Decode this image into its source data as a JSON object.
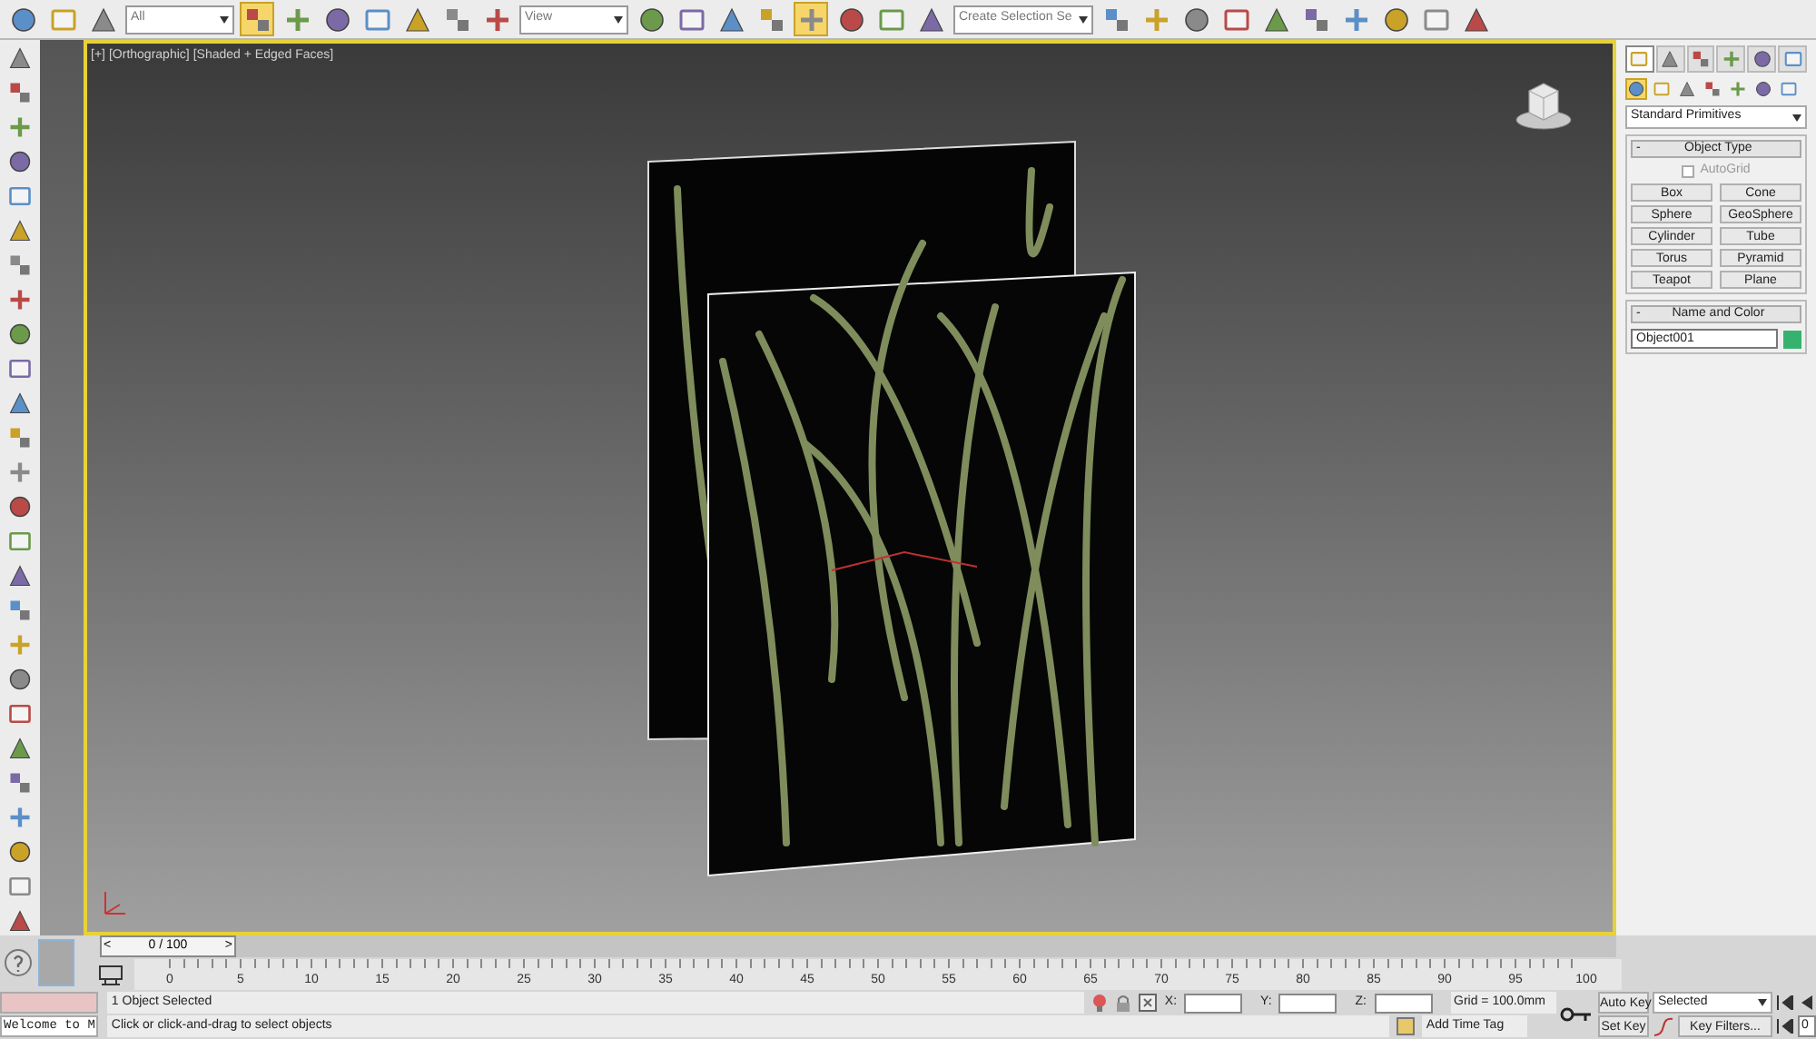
{
  "toolbar": {
    "items": [
      {
        "kind": "icon",
        "active": false
      },
      {
        "kind": "icon",
        "active": false
      },
      {
        "kind": "icon",
        "active": false
      },
      {
        "kind": "dropdown",
        "value": "All"
      },
      {
        "kind": "icon",
        "active": true
      },
      {
        "kind": "icon",
        "active": false
      },
      {
        "kind": "icon",
        "active": false
      },
      {
        "kind": "icon",
        "active": false
      },
      {
        "kind": "icon",
        "active": false
      },
      {
        "kind": "icon",
        "active": false
      },
      {
        "kind": "icon",
        "active": false
      },
      {
        "kind": "dropdown",
        "value": "View"
      },
      {
        "kind": "icon",
        "active": false
      },
      {
        "kind": "icon",
        "active": false
      },
      {
        "kind": "icon",
        "active": false
      },
      {
        "kind": "icon",
        "active": false
      },
      {
        "kind": "icon",
        "active": true
      },
      {
        "kind": "icon",
        "active": false
      },
      {
        "kind": "icon",
        "active": false
      },
      {
        "kind": "icon",
        "active": false
      },
      {
        "kind": "dropdown",
        "value": "Create Selection Se"
      },
      {
        "kind": "icon",
        "active": false
      },
      {
        "kind": "icon",
        "active": false
      },
      {
        "kind": "icon",
        "active": false
      },
      {
        "kind": "icon",
        "active": false
      },
      {
        "kind": "icon",
        "active": false
      },
      {
        "kind": "icon",
        "active": false
      },
      {
        "kind": "icon",
        "active": false
      },
      {
        "kind": "icon",
        "active": false
      },
      {
        "kind": "icon",
        "active": false
      },
      {
        "kind": "icon",
        "active": false
      }
    ]
  },
  "viewport": {
    "labels": [
      "[+]",
      "[Orthographic]",
      "[Shaded + Edged Faces]"
    ]
  },
  "command_panel": {
    "tabs": [
      {
        "selected": true
      },
      {
        "selected": false
      },
      {
        "selected": false
      },
      {
        "selected": false
      },
      {
        "selected": false
      },
      {
        "selected": false
      }
    ],
    "categories": [
      {
        "selected": true
      },
      {
        "selected": false
      },
      {
        "selected": false
      },
      {
        "selected": false
      },
      {
        "selected": false
      },
      {
        "selected": false
      },
      {
        "selected": false
      }
    ],
    "dropdown": "Standard Primitives",
    "object_type": {
      "collapse": "-",
      "title": "Object Type",
      "autogrid": {
        "label": "AutoGrid",
        "checked": false,
        "disabled": true
      },
      "buttons": [
        "Box",
        "Cone",
        "Sphere",
        "GeoSphere",
        "Cylinder",
        "Tube",
        "Torus",
        "Pyramid",
        "Teapot",
        "Plane"
      ]
    },
    "name_and_color": {
      "collapse": "-",
      "title": "Name and Color",
      "name": "Object001",
      "color": "#35b36e"
    }
  },
  "timeline": {
    "prev": "<",
    "frame": "0 / 100",
    "next": ">",
    "level": 0,
    "ticks": [
      "0",
      "5",
      "10",
      "15",
      "20",
      "25",
      "30",
      "35",
      "40",
      "45",
      "50",
      "55",
      "60",
      "65",
      "70",
      "75",
      "80",
      "85",
      "90",
      "95",
      "100"
    ]
  },
  "status": {
    "maxscript": "Welcome to M",
    "selection": "1 Object Selected",
    "prompt": "Click or click-and-drag to select objects",
    "x_label": "X:",
    "y_label": "Y:",
    "z_label": "Z:",
    "grid": "Grid = 100.0mm",
    "add_time_tag": "Add Time Tag",
    "auto_key": "Auto Key",
    "key_mode": "Selected",
    "set_key": "Set Key",
    "key_filters": "Key Filters...",
    "frame_field": "0"
  }
}
